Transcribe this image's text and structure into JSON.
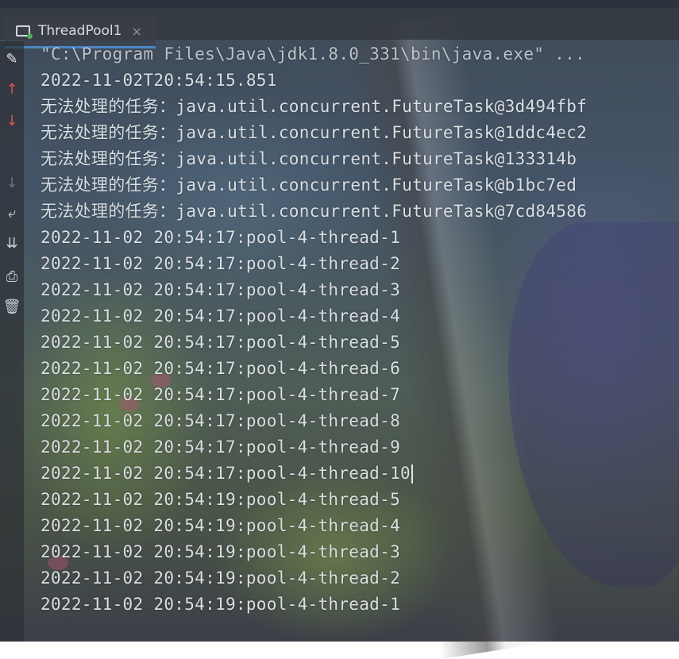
{
  "run_tab": {
    "label": "ThreadPool1",
    "close": "×"
  },
  "toolbar": [
    {
      "name": "rerun-icon",
      "glyph": "✎",
      "color": "#e8e8e8"
    },
    {
      "name": "scroll-up-icon",
      "glyph": "↑",
      "color": "#e05252"
    },
    {
      "name": "scroll-down-icon",
      "glyph": "↓",
      "color": "#e05252"
    },
    {
      "name": "disabled-icon",
      "glyph": "↓",
      "color": "#6a717a"
    },
    {
      "name": "soft-wrap-icon",
      "glyph": "⤶",
      "color": "#c9cfd5"
    },
    {
      "name": "scroll-to-end-icon",
      "glyph": "⇊",
      "color": "#c9cfd5"
    },
    {
      "name": "print-icon",
      "glyph": "⎙",
      "color": "#c9cfd5"
    },
    {
      "name": "trash-icon",
      "glyph": "🗑",
      "color": "#c9cfd5"
    }
  ],
  "console": {
    "lines": [
      "\"C:\\Program Files\\Java\\jdk1.8.0_331\\bin\\java.exe\" ...",
      "2022-11-02T20:54:15.851",
      "无法处理的任务：java.util.concurrent.FutureTask@3d494fbf",
      "无法处理的任务：java.util.concurrent.FutureTask@1ddc4ec2",
      "无法处理的任务：java.util.concurrent.FutureTask@133314b",
      "无法处理的任务：java.util.concurrent.FutureTask@b1bc7ed",
      "无法处理的任务：java.util.concurrent.FutureTask@7cd84586",
      "2022-11-02 20:54:17:pool-4-thread-1",
      "2022-11-02 20:54:17:pool-4-thread-2",
      "2022-11-02 20:54:17:pool-4-thread-3",
      "2022-11-02 20:54:17:pool-4-thread-4",
      "2022-11-02 20:54:17:pool-4-thread-5",
      "2022-11-02 20:54:17:pool-4-thread-6",
      "2022-11-02 20:54:17:pool-4-thread-7",
      "2022-11-02 20:54:17:pool-4-thread-8",
      "2022-11-02 20:54:17:pool-4-thread-9",
      "2022-11-02 20:54:17:pool-4-thread-10",
      "2022-11-02 20:54:19:pool-4-thread-5",
      "2022-11-02 20:54:19:pool-4-thread-4",
      "2022-11-02 20:54:19:pool-4-thread-3",
      "2022-11-02 20:54:19:pool-4-thread-2",
      "2022-11-02 20:54:19:pool-4-thread-1"
    ]
  },
  "colors": {
    "tab_underline": "#4a88c7",
    "text": "#dadfe3"
  }
}
